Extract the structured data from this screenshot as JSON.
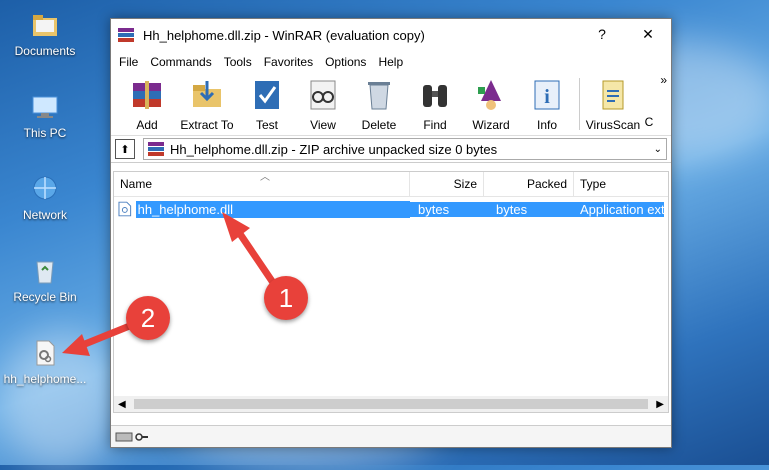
{
  "desktop": {
    "icons": [
      {
        "label": "Documents"
      },
      {
        "label": "This PC"
      },
      {
        "label": "Network"
      },
      {
        "label": "Recycle Bin"
      },
      {
        "label": "hh_helphome..."
      }
    ]
  },
  "window": {
    "title": "Hh_helphome.dll.zip - WinRAR (evaluation copy)",
    "help_glyph": "?",
    "close_glyph": "✕"
  },
  "menu": [
    "File",
    "Commands",
    "Tools",
    "Favorites",
    "Options",
    "Help"
  ],
  "toolbar": [
    "Add",
    "Extract To",
    "Test",
    "View",
    "Delete",
    "Find",
    "Wizard",
    "Info",
    "VirusScan",
    "C"
  ],
  "toolbar_overflow": "»",
  "address": {
    "up_glyph": "⬆",
    "text": "Hh_helphome.dll.zip - ZIP archive unpacked size 0 bytes",
    "dropdown_glyph": "⌄"
  },
  "columns": [
    "Name",
    "Size",
    "Packed",
    "Type"
  ],
  "files": [
    {
      "name": "hh_helphome.dll",
      "size": "bytes",
      "packed": "bytes",
      "type": "Application exte"
    }
  ],
  "annotations": [
    "1",
    "2"
  ],
  "colors": {
    "selection": "#3399ff",
    "arrow": "#e8413a",
    "accent": "#0078d7"
  }
}
